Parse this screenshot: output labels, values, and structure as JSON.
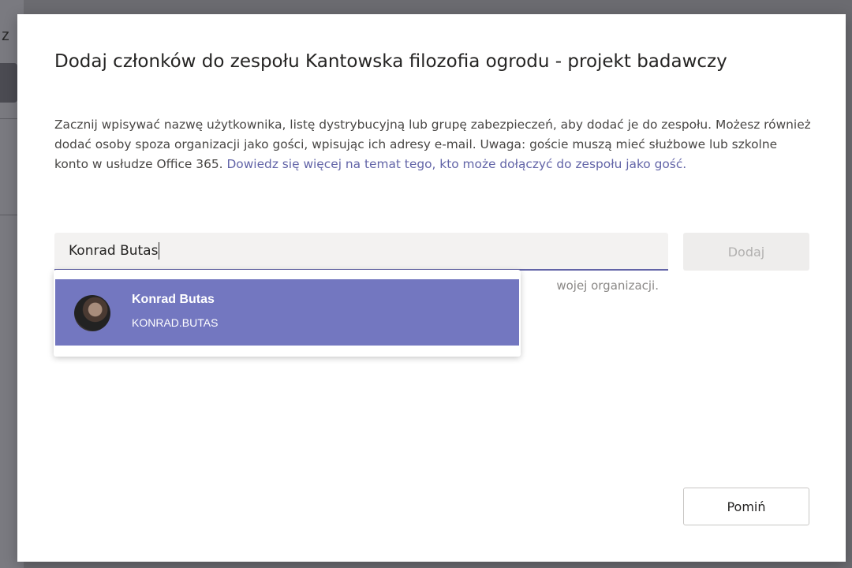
{
  "background": {
    "partial_letter": "z"
  },
  "dialog": {
    "title": "Dodaj członków do zespołu Kantowska filozofia ogrodu - projekt badawczy",
    "description": "Zacznij wpisywać nazwę użytkownika, listę dystrybucyjną lub grupę zabezpieczeń, aby dodać je do zespołu. Możesz również dodać osoby spoza organizacji jako gości, wpisując ich adresy e-mail. Uwaga: goście muszą mieć służbowe lub szkolne konto w usłudze Office 365. ",
    "learn_more_link": "Dowiedz się więcej na temat tego, kto może dołączyć do zespołu jako gość.",
    "search_value": "Konrad Butas",
    "add_button": "Dodaj",
    "hint_partial": "wojej organizacji.",
    "suggestion": {
      "name": "Konrad Butas",
      "id": "KONRAD.BUTAS"
    },
    "skip_button": "Pomiń"
  },
  "colors": {
    "accent": "#6264a7",
    "suggestion_highlight": "#7377c0"
  }
}
